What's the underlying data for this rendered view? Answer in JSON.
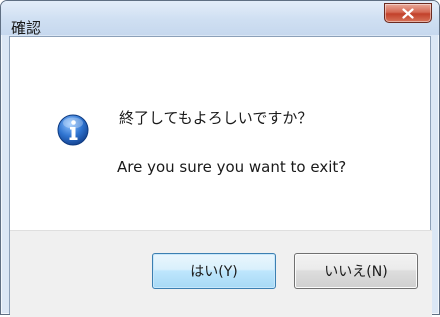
{
  "dialog": {
    "title": "確認",
    "message": "終了してもよろしいですか？",
    "message_en": "Are you sure you want to exit?",
    "icon": "info-icon",
    "buttons": {
      "yes_label": "はい(Y)",
      "no_label": "いいえ(N)"
    }
  },
  "colors": {
    "titlebar": "#cfdff2",
    "close_button": "#c2412a",
    "default_button_border": "#3c7fb1",
    "footer": "#f0f0f0"
  }
}
